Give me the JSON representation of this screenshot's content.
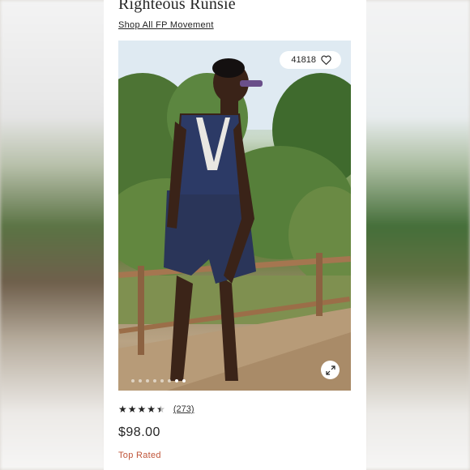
{
  "product": {
    "title": "Righteous Runsie",
    "shop_link": "Shop All FP Movement",
    "likes": "41818",
    "rating": 4.5,
    "review_count": "(273)",
    "price": "$98.00",
    "badge": "Top Rated"
  },
  "carousel": {
    "total_images": 8,
    "current_index": 0
  },
  "icons": {
    "like": "heart-icon",
    "expand": "expand-icon",
    "star": "star-icon"
  },
  "colors": {
    "badge": "#c0553a",
    "text": "#262626"
  }
}
